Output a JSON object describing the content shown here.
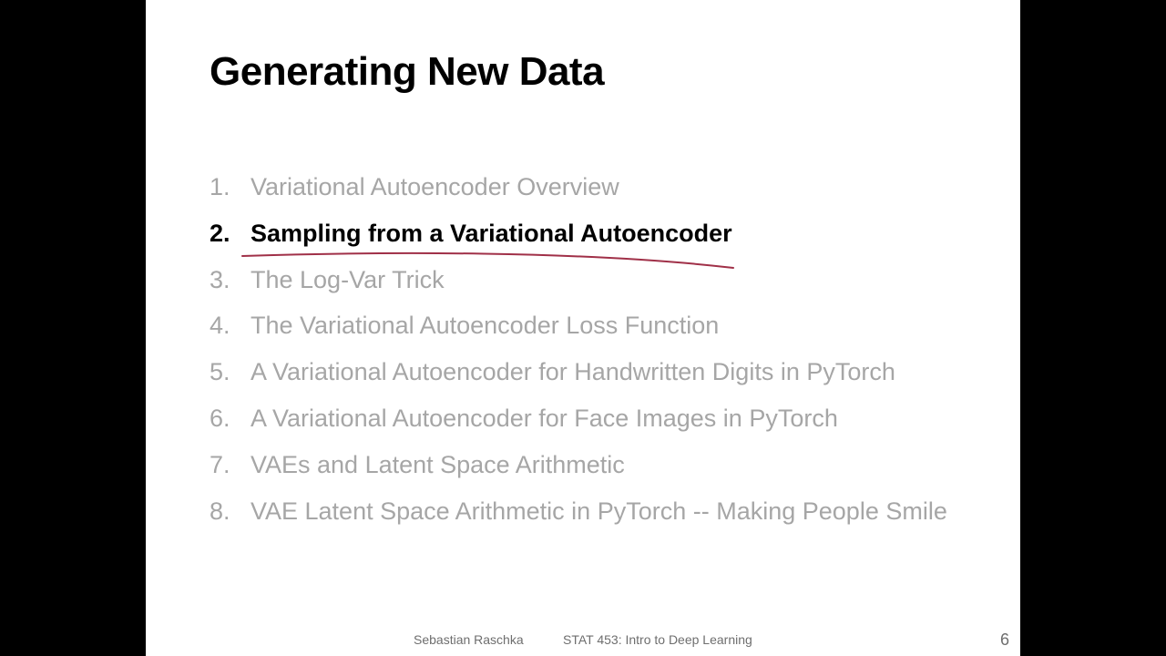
{
  "slide": {
    "title": "Generating New Data",
    "agenda": [
      {
        "number": "1.",
        "text": "Variational Autoencoder Overview",
        "active": false
      },
      {
        "number": "2.",
        "text": "Sampling from a Variational Autoencoder",
        "active": true
      },
      {
        "number": "3.",
        "text": "The Log-Var Trick",
        "active": false
      },
      {
        "number": "4.",
        "text": "The Variational Autoencoder Loss Function",
        "active": false
      },
      {
        "number": "5.",
        "text": "A Variational Autoencoder for Handwritten Digits in PyTorch",
        "active": false
      },
      {
        "number": "6.",
        "text": "A Variational Autoencoder for Face Images in PyTorch",
        "active": false
      },
      {
        "number": "7.",
        "text": "VAEs and Latent Space Arithmetic",
        "active": false
      },
      {
        "number": "8.",
        "text": "VAE Latent Space Arithmetic in PyTorch -- Making People Smile",
        "active": false
      }
    ],
    "footer": {
      "author": "Sebastian Raschka",
      "course": "STAT 453: Intro to Deep Learning",
      "page_number": "6"
    }
  },
  "colors": {
    "active_text": "#000000",
    "inactive_text": "#a6a6a6",
    "annotation_stroke": "#a03048",
    "footer_text": "#6e6e6e"
  }
}
